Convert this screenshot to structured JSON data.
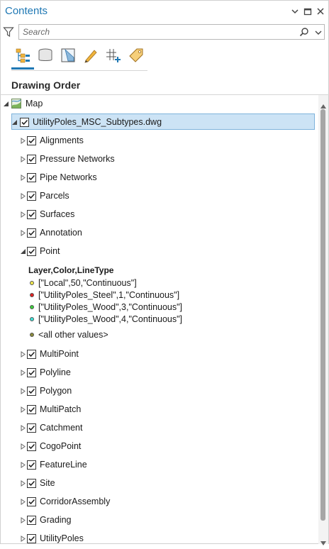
{
  "window": {
    "title": "Contents",
    "controls": [
      "dropdown-icon",
      "restore-icon",
      "close-icon"
    ]
  },
  "search": {
    "placeholder": "Search",
    "value": ""
  },
  "toolbar": {
    "buttons": [
      {
        "icon": "drawing-order-icon",
        "active": true
      },
      {
        "icon": "data-source-icon",
        "active": false
      },
      {
        "icon": "selection-icon",
        "active": false
      },
      {
        "icon": "editing-icon",
        "active": false
      },
      {
        "icon": "snapping-icon",
        "active": false
      },
      {
        "icon": "labeling-icon",
        "active": false
      }
    ]
  },
  "section": {
    "title": "Drawing Order"
  },
  "tree": {
    "map_label": "Map",
    "dataset_label": "UtilityPoles_MSC_Subtypes.dwg",
    "layers_before": [
      "Alignments",
      "Pressure Networks",
      "Pipe Networks",
      "Parcels",
      "Surfaces",
      "Annotation"
    ],
    "point_label": "Point",
    "legend": {
      "heading": "Layer,Color,LineType",
      "items": [
        {
          "label": "[\"Local\",50,\"Continuous\"]",
          "color": "#f2e94e"
        },
        {
          "label": "[\"UtilityPoles_Steel\",1,\"Continuous\"]",
          "color": "#e02020"
        },
        {
          "label": "[\"UtilityPoles_Wood\",3,\"Continuous\"]",
          "color": "#3ccf3c"
        },
        {
          "label": "[\"UtilityPoles_Wood\",4,\"Continuous\"]",
          "color": "#3ee0d6"
        }
      ],
      "other": {
        "label": "<all other values>",
        "color": "#8a8a3a"
      }
    },
    "layers_after": [
      "MultiPoint",
      "Polyline",
      "Polygon",
      "MultiPatch",
      "Catchment",
      "CogoPoint",
      "FeatureLine",
      "Site",
      "CorridorAssembly",
      "Grading",
      "UtilityPoles"
    ]
  },
  "colors": {
    "accent": "#1f78b4",
    "selection": "#cce3f5"
  }
}
